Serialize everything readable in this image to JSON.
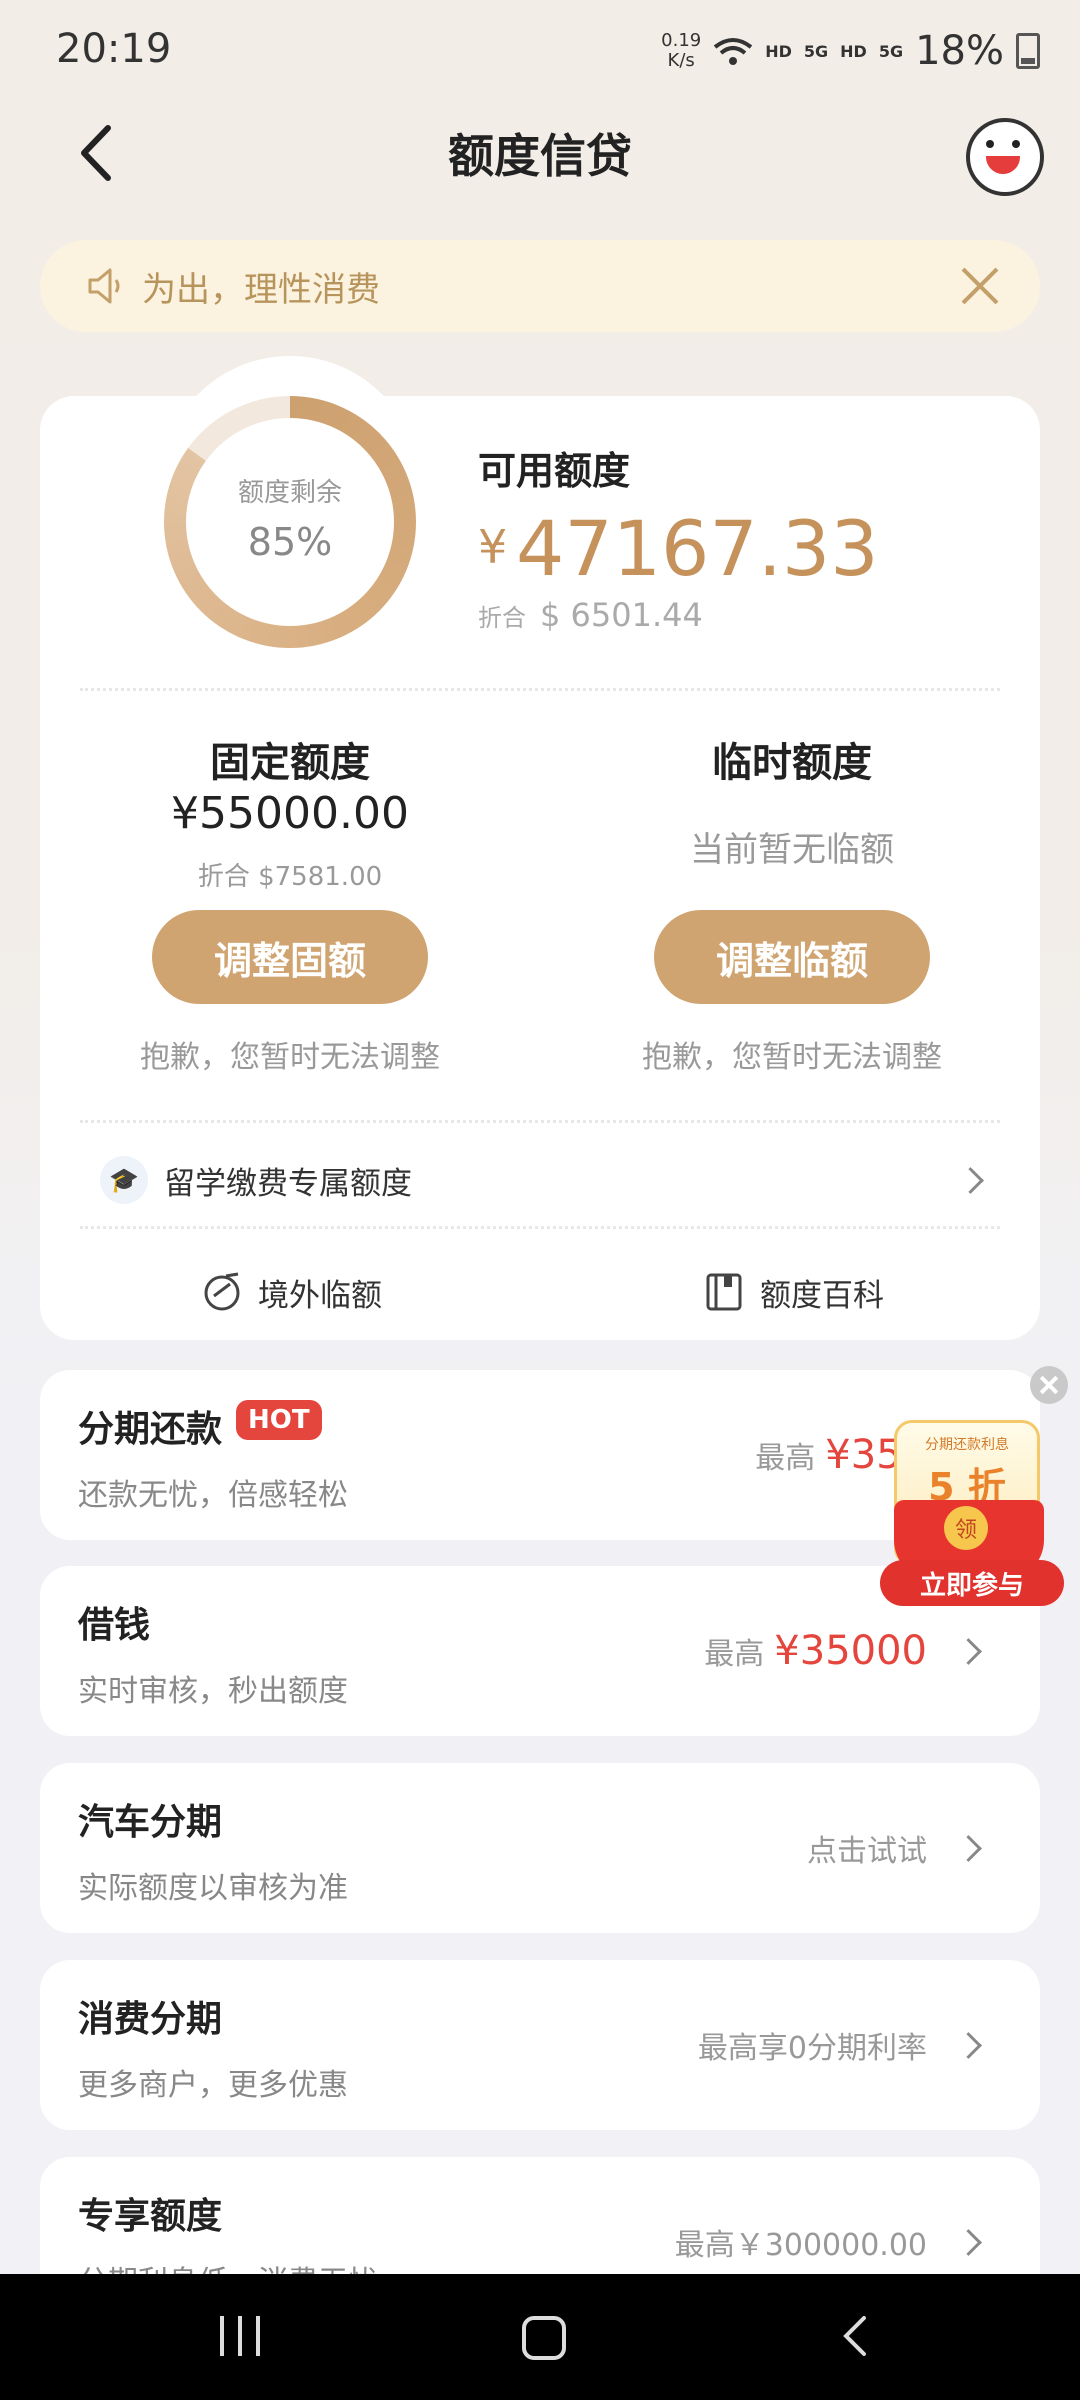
{
  "status_bar": {
    "time": "20:19",
    "net_speed": "0.19",
    "net_unit": "K/s",
    "sig1": "HD",
    "sig2": "5G",
    "sig3": "HD",
    "sig4": "5G",
    "battery": "18%"
  },
  "header": {
    "title": "额度信贷",
    "back_icon": "chevron-left-icon",
    "mascot_icon": "mascot-avatar-icon"
  },
  "notice": {
    "text": "为出，理性消费"
  },
  "credit": {
    "ring_label": "额度剩余",
    "ring_percent": "85%",
    "ring_fraction": 0.85,
    "available_title": "可用额度",
    "available_currency": "¥",
    "available_amount": "47167.33",
    "converted_label": "折合",
    "converted_amount": "$ 6501.44",
    "fixed": {
      "title": "固定额度",
      "amount": "¥55000.00",
      "converted": "折合 $7581.00",
      "button": "调整固额",
      "note": "抱歉，您暂时无法调整"
    },
    "temporary": {
      "title": "临时额度",
      "status": "当前暂无临额",
      "button": "调整临额",
      "note": "抱歉，您暂时无法调整"
    },
    "study": {
      "label": "留学缴费专属额度"
    },
    "quick_links": [
      {
        "label": "境外临额"
      },
      {
        "label": "额度百科"
      }
    ]
  },
  "products": [
    {
      "title": "分期还款",
      "badge": "HOT",
      "subtitle": "还款无忧，倍感轻松",
      "right_label": "最高",
      "right_amount": "¥35010"
    },
    {
      "title": "借钱",
      "subtitle": "实时审核，秒出额度",
      "right_label": "最高",
      "right_amount": "¥35000"
    },
    {
      "title": "汽车分期",
      "subtitle": "实际额度以审核为准",
      "right_label": "点击试试"
    },
    {
      "title": "消费分期",
      "subtitle": "更多商户，更多优惠",
      "right_label": "最高享0分期利率"
    },
    {
      "title": "专享额度",
      "subtitle": "分期利息低，消费无忧",
      "right_label": "最高￥300000.00"
    }
  ],
  "promo": {
    "small_text": "分期还款利息",
    "discount": "5 折",
    "coin": "领",
    "cta": "立即参与"
  },
  "colors": {
    "accent_gold": "#d0a470",
    "price_red": "#e4453d",
    "notice_bg": "#fbf3df"
  }
}
